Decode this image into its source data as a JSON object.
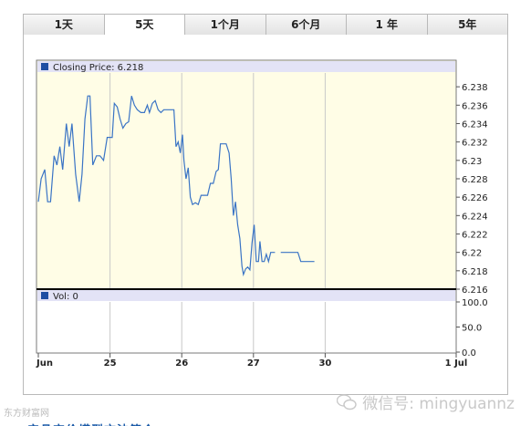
{
  "tabs": [
    {
      "label": "1天",
      "active": false
    },
    {
      "label": "5天",
      "active": true
    },
    {
      "label": "1个月",
      "active": false
    },
    {
      "label": "6个月",
      "active": false
    },
    {
      "label": "1 年",
      "active": false
    },
    {
      "label": "5年",
      "active": false
    }
  ],
  "colors": {
    "price_line": "#3a74c5",
    "price_bg": "#fffde6",
    "legend_bar": "#e3e3f6",
    "legend_swatch": "#1f4fa3",
    "grid": "#c8c8c8"
  },
  "chart_data": [
    {
      "type": "line",
      "legend": "Closing Price: 6.218",
      "ylim": [
        6.216,
        6.2395
      ],
      "yticks": [
        "6.238",
        "6.236",
        "6.234",
        "6.232",
        "6.23",
        "6.228",
        "6.226",
        "6.224",
        "6.222",
        "6.22",
        "6.218",
        "6.216"
      ],
      "xticks": [
        "Jun",
        "25",
        "26",
        "27",
        "30",
        "1 Jul"
      ],
      "grid": true,
      "series": [
        {
          "values": [
            [
              0,
              6.2255
            ],
            [
              0.04,
              6.228
            ],
            [
              0.09,
              6.229
            ],
            [
              0.13,
              6.2255
            ],
            [
              0.17,
              6.2255
            ],
            [
              0.22,
              6.2305
            ],
            [
              0.26,
              6.2295
            ],
            [
              0.3,
              6.2315
            ],
            [
              0.34,
              6.229
            ],
            [
              0.39,
              6.234
            ],
            [
              0.43,
              6.2315
            ],
            [
              0.47,
              6.234
            ],
            [
              0.52,
              6.2285
            ],
            [
              0.57,
              6.2255
            ],
            [
              0.61,
              6.2285
            ],
            [
              0.65,
              6.2345
            ],
            [
              0.69,
              6.237
            ],
            [
              0.72,
              6.237
            ],
            [
              0.76,
              6.2295
            ],
            [
              0.81,
              6.2305
            ],
            [
              0.86,
              6.2305
            ],
            [
              0.91,
              6.23
            ],
            [
              0.96,
              6.2325
            ],
            [
              1.0,
              6.2325
            ],
            [
              1.03,
              6.2325
            ],
            [
              1.06,
              6.2362
            ],
            [
              1.1,
              6.2358
            ],
            [
              1.14,
              6.2345
            ],
            [
              1.18,
              6.2335
            ],
            [
              1.22,
              6.234
            ],
            [
              1.26,
              6.2342
            ],
            [
              1.3,
              6.237
            ],
            [
              1.34,
              6.236
            ],
            [
              1.38,
              6.2355
            ],
            [
              1.43,
              6.2352
            ],
            [
              1.48,
              6.2352
            ],
            [
              1.52,
              6.236
            ],
            [
              1.55,
              6.2352
            ],
            [
              1.59,
              6.2362
            ],
            [
              1.63,
              6.2365
            ],
            [
              1.67,
              6.2355
            ],
            [
              1.71,
              6.2352
            ],
            [
              1.75,
              6.2355
            ],
            [
              1.8,
              6.2355
            ],
            [
              1.85,
              6.2355
            ],
            [
              1.89,
              6.2355
            ],
            [
              1.92,
              6.2315
            ],
            [
              1.95,
              6.232
            ],
            [
              1.98,
              6.2308
            ],
            [
              2.01,
              6.2328
            ],
            [
              2.03,
              6.23
            ],
            [
              2.06,
              6.228
            ],
            [
              2.09,
              6.2292
            ],
            [
              2.12,
              6.226
            ],
            [
              2.15,
              6.2252
            ],
            [
              2.19,
              6.2254
            ],
            [
              2.23,
              6.2252
            ],
            [
              2.27,
              6.2262
            ],
            [
              2.31,
              6.2262
            ],
            [
              2.36,
              6.2262
            ],
            [
              2.4,
              6.2275
            ],
            [
              2.44,
              6.2275
            ],
            [
              2.48,
              6.2288
            ],
            [
              2.51,
              6.229
            ],
            [
              2.54,
              6.2318
            ],
            [
              2.58,
              6.2318
            ],
            [
              2.62,
              6.2318
            ],
            [
              2.66,
              6.2308
            ],
            [
              2.69,
              6.228
            ],
            [
              2.72,
              6.224
            ],
            [
              2.75,
              6.2255
            ],
            [
              2.78,
              6.223
            ],
            [
              2.81,
              6.2215
            ],
            [
              2.84,
              6.2185
            ],
            [
              2.86,
              6.2176
            ],
            [
              2.89,
              6.2182
            ],
            [
              2.92,
              6.2184
            ],
            [
              2.95,
              6.2181
            ],
            [
              2.98,
              6.221
            ],
            [
              3.01,
              6.223
            ],
            [
              3.04,
              6.219
            ],
            [
              3.07,
              6.219
            ],
            [
              3.09,
              6.2212
            ],
            [
              3.12,
              6.219
            ],
            [
              3.15,
              6.219
            ],
            [
              3.18,
              6.2198
            ],
            [
              3.21,
              6.219
            ],
            [
              3.24,
              6.22
            ],
            [
              3.27,
              6.22
            ],
            [
              3.3,
              6.22
            ]
          ]
        },
        {
          "values": [
            [
              3.38,
              6.22
            ],
            [
              3.46,
              6.22
            ],
            [
              3.54,
              6.22
            ],
            [
              3.62,
              6.22
            ],
            [
              3.66,
              6.219
            ],
            [
              3.72,
              6.219
            ],
            [
              3.8,
              6.219
            ],
            [
              3.85,
              6.219
            ]
          ]
        }
      ]
    },
    {
      "type": "bar",
      "legend": "Vol: 0",
      "ylim": [
        0,
        100
      ],
      "yticks": [
        "100.0",
        "50.0",
        "0.0"
      ],
      "values": []
    }
  ],
  "footer": {
    "watermark_left": "东方财富网",
    "wechat_id": "微信号: mingyuannz",
    "bottom_text": "产品定价模型方法简介"
  }
}
